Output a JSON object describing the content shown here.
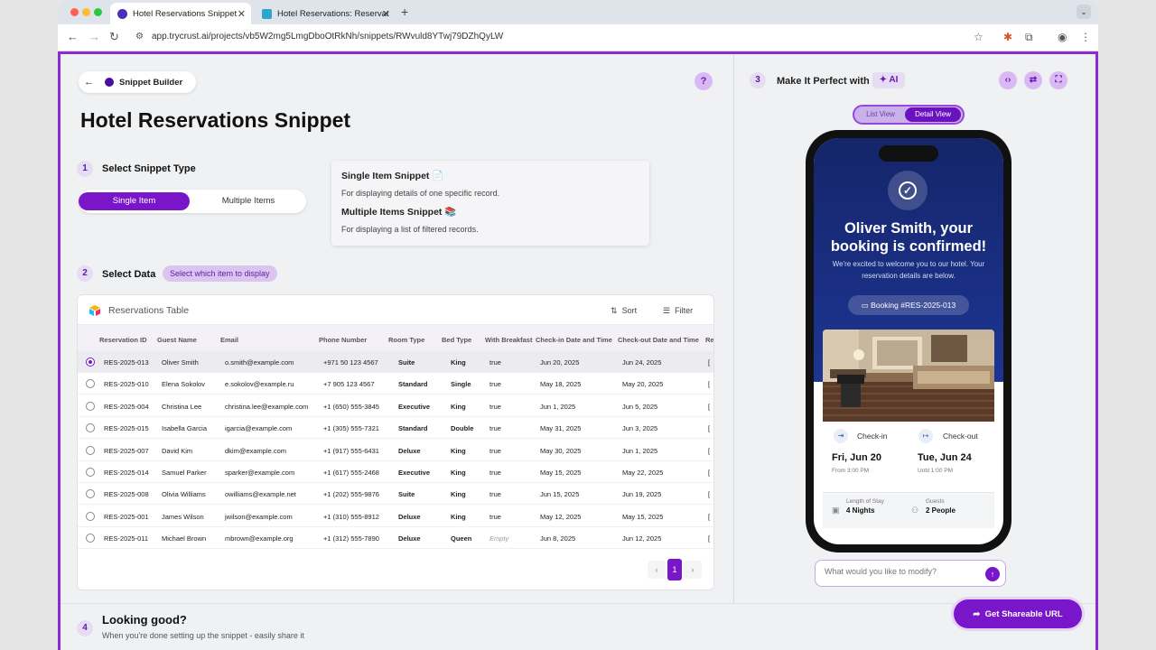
{
  "browser": {
    "tabs": [
      {
        "title": "Hotel Reservations Snippet",
        "active": true
      },
      {
        "title": "Hotel Reservations: Reservat",
        "active": false
      }
    ],
    "url": "app.trycrust.ai/projects/vb5W2mg5LmgDboOtRkNh/snippets/RWvuld8YTwj79DZhQyLW"
  },
  "header": {
    "back_label": "Snippet Builder",
    "page_title": "Hotel Reservations Snippet"
  },
  "step1": {
    "num": "1",
    "label": "Select Snippet Type",
    "options": [
      "Single Item",
      "Multiple Items"
    ],
    "selected": "Single Item",
    "info": {
      "single_title": "Single Item Snippet 📄",
      "single_desc": "For displaying details of one specific record.",
      "multi_title": "Multiple Items Snippet 📚",
      "multi_desc": "For displaying a list of filtered records."
    }
  },
  "step2": {
    "num": "2",
    "label": "Select Data",
    "badge": "Select which item to display"
  },
  "table": {
    "name": "Reservations Table",
    "sort_label": "Sort",
    "filter_label": "Filter",
    "columns": [
      "Reservation ID",
      "Guest Name",
      "Email",
      "Phone Number",
      "Room Type",
      "Bed Type",
      "With Breakfast",
      "Check-in Date and Time",
      "Check-out Date and Time",
      "Re"
    ],
    "rows": [
      {
        "id": "RES-2025-013",
        "name": "Oliver Smith",
        "email": "o.smith@example.com",
        "phone": "+971 50 123 4567",
        "room": "Suite",
        "bed": "King",
        "breakfast": "true",
        "checkin": "Jun 20, 2025",
        "checkout": "Jun 24, 2025",
        "selected": true
      },
      {
        "id": "RES-2025-010",
        "name": "Elena Sokolov",
        "email": "e.sokolov@example.ru",
        "phone": "+7 905 123 4567",
        "room": "Standard",
        "bed": "Single",
        "breakfast": "true",
        "checkin": "May 18, 2025",
        "checkout": "May 20, 2025"
      },
      {
        "id": "RES-2025-004",
        "name": "Christina Lee",
        "email": "christina.lee@example.com",
        "phone": "+1 (650) 555-3845",
        "room": "Executive",
        "bed": "King",
        "breakfast": "true",
        "checkin": "Jun 1, 2025",
        "checkout": "Jun 5, 2025"
      },
      {
        "id": "RES-2025-015",
        "name": "Isabella Garcia",
        "email": "igarcia@example.com",
        "phone": "+1 (305) 555-7321",
        "room": "Standard",
        "bed": "Double",
        "breakfast": "true",
        "checkin": "May 31, 2025",
        "checkout": "Jun 3, 2025"
      },
      {
        "id": "RES-2025-007",
        "name": "David Kim",
        "email": "dkim@example.com",
        "phone": "+1 (917) 555-6431",
        "room": "Deluxe",
        "bed": "King",
        "breakfast": "true",
        "checkin": "May 30, 2025",
        "checkout": "Jun 1, 2025"
      },
      {
        "id": "RES-2025-014",
        "name": "Samuel Parker",
        "email": "sparker@example.com",
        "phone": "+1 (617) 555-2468",
        "room": "Executive",
        "bed": "King",
        "breakfast": "true",
        "checkin": "May 15, 2025",
        "checkout": "May 22, 2025"
      },
      {
        "id": "RES-2025-008",
        "name": "Olivia Williams",
        "email": "owilliams@example.net",
        "phone": "+1 (202) 555-9876",
        "room": "Suite",
        "bed": "King",
        "breakfast": "true",
        "checkin": "Jun 15, 2025",
        "checkout": "Jun 19, 2025"
      },
      {
        "id": "RES-2025-001",
        "name": "James Wilson",
        "email": "jwilson@example.com",
        "phone": "+1 (310) 555-8912",
        "room": "Deluxe",
        "bed": "King",
        "breakfast": "true",
        "checkin": "May 12, 2025",
        "checkout": "May 15, 2025"
      },
      {
        "id": "RES-2025-011",
        "name": "Michael Brown",
        "email": "mbrown@example.org",
        "phone": "+1 (312) 555-7890",
        "room": "Deluxe",
        "bed": "Queen",
        "breakfast": "Empty",
        "checkin": "Jun 8, 2025",
        "checkout": "Jun 12, 2025"
      }
    ],
    "page": "1"
  },
  "step4": {
    "num": "4",
    "title": "Looking good?",
    "subtitle": "When you're done setting up the snippet - easily share it",
    "share_label": "Get Shareable URL"
  },
  "right": {
    "step_num": "3",
    "title": "Make It Perfect with",
    "ai_label": "AI",
    "view_options": [
      "List View",
      "Detail View"
    ],
    "selected_view": "Detail View",
    "preview": {
      "headline": "Oliver Smith, your booking is confirmed!",
      "subtext": "We're excited to welcome you to our hotel. Your reservation details are below.",
      "booking": "Booking #RES-2025-013",
      "checkin_label": "Check-in",
      "checkout_label": "Check-out",
      "checkin_date": "Fri, Jun 20",
      "checkout_date": "Tue, Jun 24",
      "checkin_time": "From 3:00 PM",
      "checkout_time": "Until 1:00 PM",
      "stay_label": "Length of Stay",
      "stay_value": "4 Nights",
      "guests_label": "Guests",
      "guests_value": "2 People"
    },
    "prompt_placeholder": "What would you like to modify?"
  },
  "colors": {
    "accent": "#7a16c9",
    "hero": "#1d3593"
  }
}
